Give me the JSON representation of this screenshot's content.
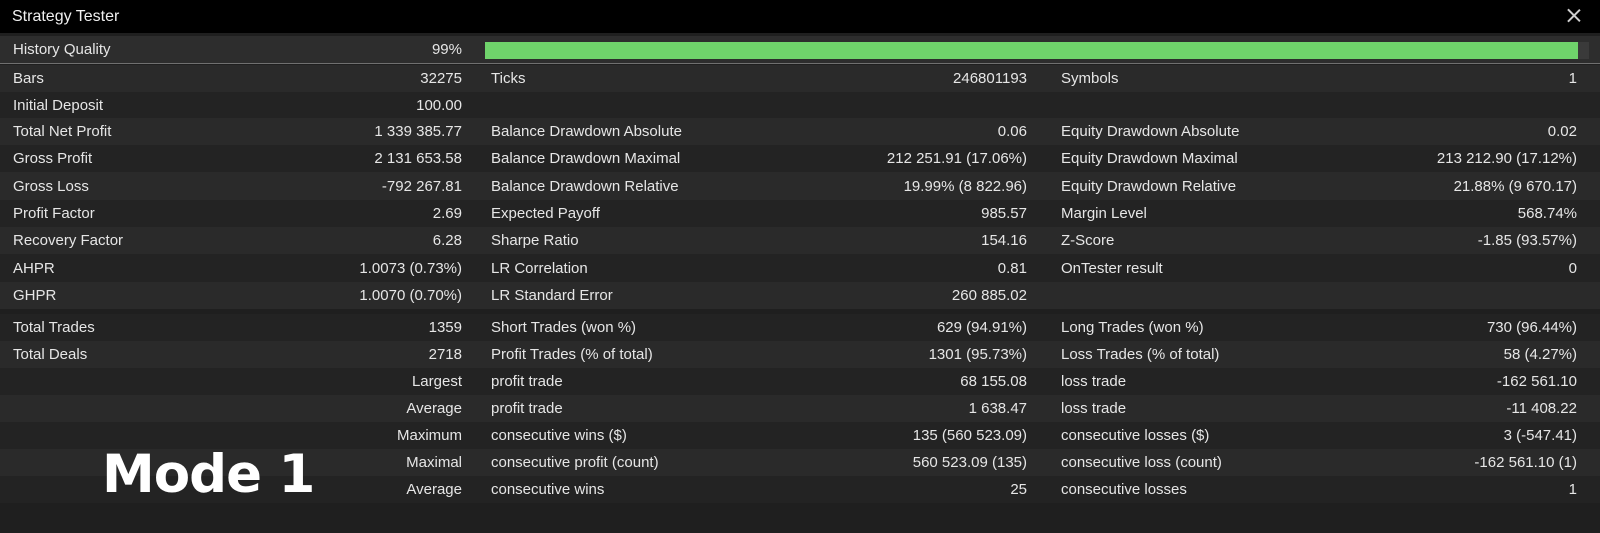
{
  "window": {
    "title": "Strategy Tester"
  },
  "history_quality": {
    "label": "History Quality",
    "value": "99%",
    "fill_fraction": 0.99,
    "bar_color": "#6fd36b"
  },
  "rows": [
    [
      "Bars",
      "32275",
      "Ticks",
      "246801193",
      "Symbols",
      "1"
    ],
    [
      "Initial Deposit",
      "100.00",
      "",
      "",
      "",
      ""
    ],
    [
      "Total Net Profit",
      "1 339 385.77",
      "Balance Drawdown Absolute",
      "0.06",
      "Equity Drawdown Absolute",
      "0.02"
    ],
    [
      "Gross Profit",
      "2 131 653.58",
      "Balance Drawdown Maximal",
      "212 251.91 (17.06%)",
      "Equity Drawdown Maximal",
      "213 212.90 (17.12%)"
    ],
    [
      "Gross Loss",
      "-792 267.81",
      "Balance Drawdown Relative",
      "19.99% (8 822.96)",
      "Equity Drawdown Relative",
      "21.88% (9 670.17)"
    ],
    [
      "Profit Factor",
      "2.69",
      "Expected Payoff",
      "985.57",
      "Margin Level",
      "568.74%"
    ],
    [
      "Recovery Factor",
      "6.28",
      "Sharpe Ratio",
      "154.16",
      "Z-Score",
      "-1.85 (93.57%)"
    ],
    [
      "AHPR",
      "1.0073 (0.73%)",
      "LR Correlation",
      "0.81",
      "OnTester result",
      "0"
    ],
    [
      "GHPR",
      "1.0070 (0.70%)",
      "LR Standard Error",
      "260 885.02",
      "",
      ""
    ],
    [
      "Total Trades",
      "1359",
      "Short Trades (won %)",
      "629 (94.91%)",
      "Long Trades (won %)",
      "730 (96.44%)"
    ],
    [
      "Total Deals",
      "2718",
      "Profit Trades (% of total)",
      "1301 (95.73%)",
      "Loss Trades (% of total)",
      "58 (4.27%)"
    ],
    [
      "",
      "Largest",
      "profit trade",
      "68 155.08",
      "loss trade",
      "-162 561.10"
    ],
    [
      "",
      "Average",
      "profit trade",
      "1 638.47",
      "loss trade",
      "-11 408.22"
    ],
    [
      "",
      "Maximum",
      "consecutive wins ($)",
      "135 (560 523.09)",
      "consecutive losses ($)",
      "3 (-547.41)"
    ],
    [
      "",
      "Maximal",
      "consecutive profit (count)",
      "560 523.09 (135)",
      "consecutive loss (count)",
      "-162 561.10 (1)"
    ],
    [
      "",
      "Average",
      "consecutive wins",
      "25",
      "consecutive losses",
      "1"
    ]
  ],
  "overlay_text": "Mode 1"
}
